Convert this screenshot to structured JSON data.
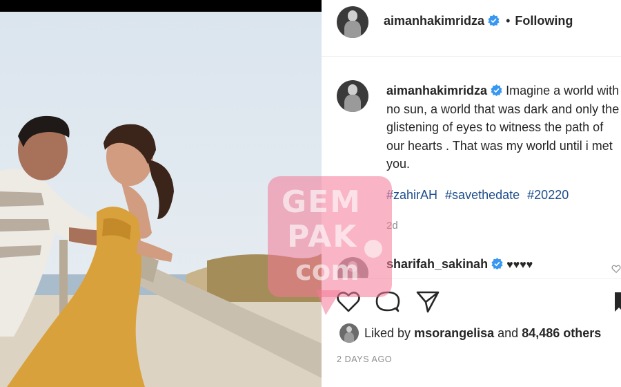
{
  "post": {
    "author": "aimanhakimridza",
    "follow_status": "Following",
    "separator": "•",
    "caption": "Imagine a world with no sun, a world that was dark and only the glistening of eyes to witness the path of our hearts . That was my world until i met you.",
    "hashtags": [
      "#zahirAH",
      "#savethedate",
      "#20220"
    ],
    "caption_time": "2d",
    "posted_date": "2 DAYS AGO"
  },
  "comment": {
    "author": "sharifah_sakinah",
    "text": "♥♥♥♥"
  },
  "likes": {
    "prefix": "Liked by",
    "user": "msorangelisa",
    "conjunction": "and",
    "others": "84,486 others"
  },
  "watermark": {
    "line1": "GEM",
    "line2": "PAK",
    "line3": "com"
  },
  "icons": {
    "like": "heart-icon",
    "comment": "comment-icon",
    "share": "share-icon",
    "save": "bookmark-icon",
    "verified": "verified-badge-icon"
  },
  "colors": {
    "verified": "#3897f0",
    "hashtag": "#1f4e8c",
    "muted": "#8e8e8e",
    "watermark": "#f47896",
    "dress": "#d9a13b"
  }
}
